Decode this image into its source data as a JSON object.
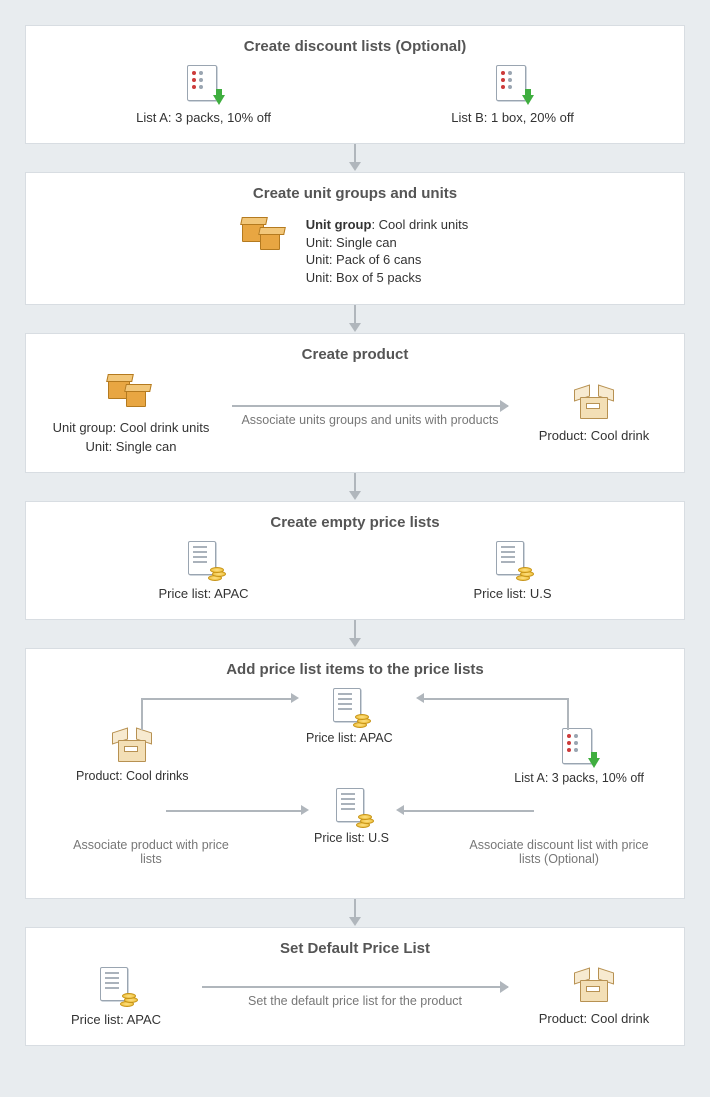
{
  "steps": {
    "s1": {
      "title": "Create discount lists (Optional)",
      "listA": "List A: 3 packs, 10% off",
      "listB": "List B: 1 box, 20% off"
    },
    "s2": {
      "title": "Create unit groups and units",
      "group_label": "Unit group",
      "group_value": ": Cool drink units",
      "unit1": "Unit: Single can",
      "unit2": "Unit: Pack of 6 cans",
      "unit3": "Unit: Box of 5 packs"
    },
    "s3": {
      "title": "Create product",
      "left_line1": "Unit group: Cool drink units",
      "left_line2": "Unit: Single can",
      "arrow_caption": "Associate units groups and units with products",
      "right": "Product: Cool drink"
    },
    "s4": {
      "title": "Create empty price lists",
      "left": "Price list: APAC",
      "right": "Price list: U.S"
    },
    "s5": {
      "title": "Add price list items to the price lists",
      "product": "Product: Cool drinks",
      "apac": "Price list: APAC",
      "us": "Price list: U.S",
      "listA": "List A: 3 packs, 10% off",
      "left_caption": "Associate product with price lists",
      "right_caption": "Associate discount list with price lists (Optional)"
    },
    "s6": {
      "title": "Set Default Price List",
      "left": "Price list: APAC",
      "arrow_caption": "Set the default price list for the product",
      "right": "Product: Cool drink"
    }
  }
}
